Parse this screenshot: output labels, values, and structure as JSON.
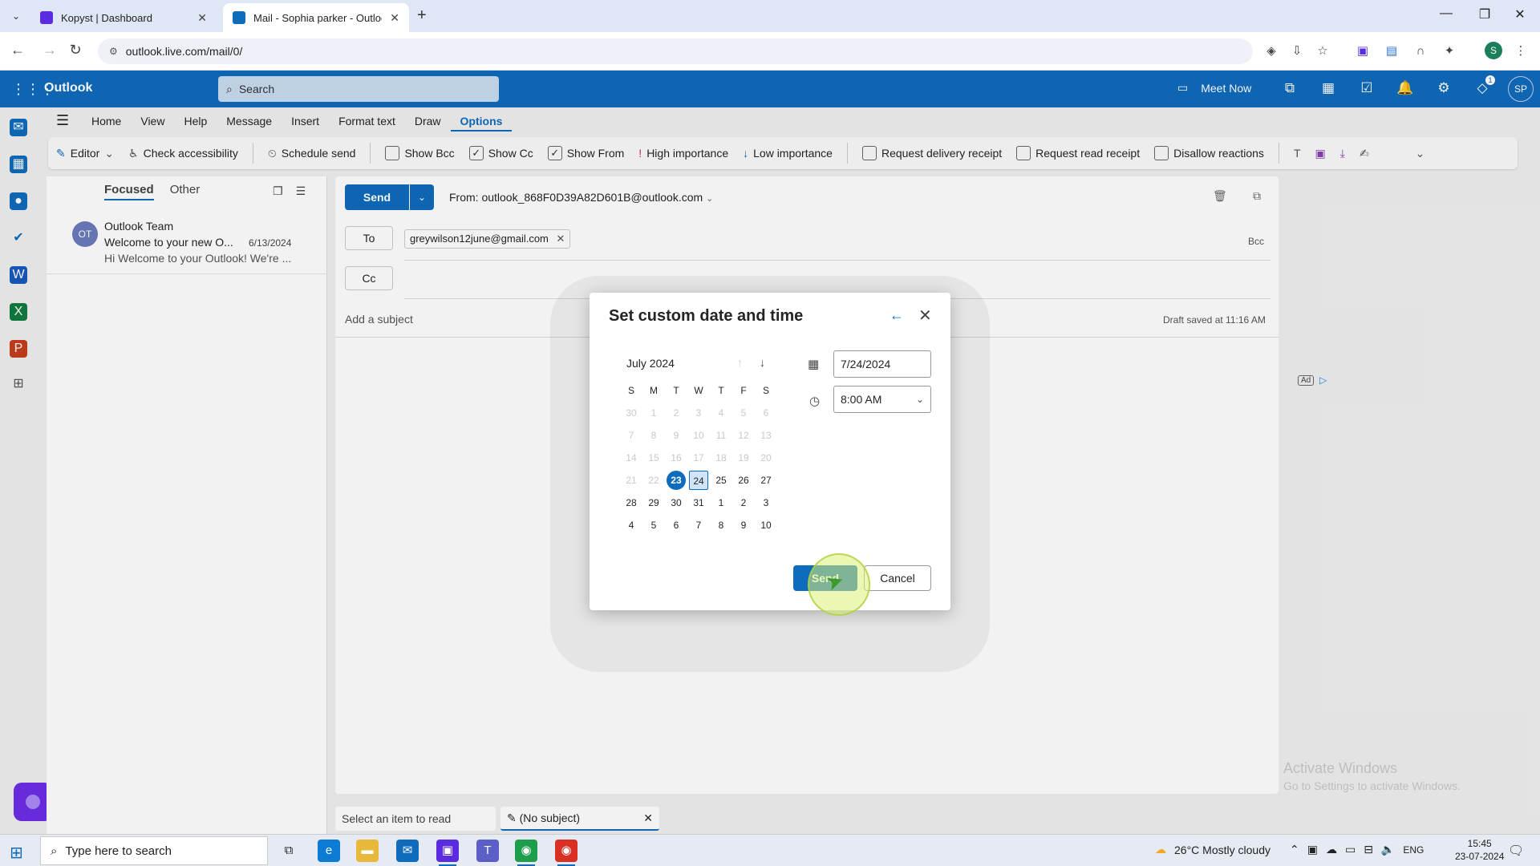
{
  "browser": {
    "tabs": [
      {
        "title": "Kopyst | Dashboard",
        "active": false,
        "favicon_color": "#5b2be0"
      },
      {
        "title": "Mail - Sophia parker - Outlook",
        "active": true,
        "favicon_color": "#0f6cbd"
      }
    ],
    "url": "outlook.live.com/mail/0/",
    "profile_initial": "S"
  },
  "outlook": {
    "brand": "Outlook",
    "search_placeholder": "Search",
    "meet_now": "Meet Now",
    "notification_badge": "1",
    "avatar_initials": "SP",
    "ribbon_tabs": [
      "Home",
      "View",
      "Help",
      "Message",
      "Insert",
      "Format text",
      "Draw",
      "Options"
    ],
    "active_ribbon_tab": "Options",
    "ribbon": {
      "editor": "Editor",
      "check_accessibility": "Check accessibility",
      "schedule_send": "Schedule send",
      "show_bcc": "Show Bcc",
      "show_cc": "Show Cc",
      "show_from": "Show From",
      "high_importance": "High importance",
      "low_importance": "Low importance",
      "request_delivery_receipt": "Request delivery receipt",
      "request_read_receipt": "Request read receipt",
      "disallow_reactions": "Disallow reactions"
    },
    "ribbon_checks": {
      "show_bcc": false,
      "show_cc": true,
      "show_from": true,
      "delivery": false,
      "read": false,
      "reactions": false
    },
    "message_list": {
      "focused": "Focused",
      "other": "Other",
      "items": [
        {
          "initials": "OT",
          "sender": "Outlook Team",
          "subject": "Welcome to your new O...",
          "date": "6/13/2024",
          "preview": "Hi Welcome to your Outlook! We're ..."
        }
      ]
    },
    "compose": {
      "send": "Send",
      "from": "From: outlook_868F0D39A82D601B@outlook.com",
      "to_label": "To",
      "cc_label": "Cc",
      "recipient": "greywilson12june@gmail.com",
      "bcc": "Bcc",
      "subject_placeholder": "Add a subject",
      "draft_saved": "Draft saved at 11:16 AM"
    },
    "bottom_tabs": {
      "select_item": "Select an item to read",
      "no_subject": "(No subject)"
    },
    "ad_label": "Ad"
  },
  "dialog": {
    "title": "Set custom date and time",
    "month": "July 2024",
    "weekdays": [
      "S",
      "M",
      "T",
      "W",
      "T",
      "F",
      "S"
    ],
    "weeks": [
      [
        "30",
        "1",
        "2",
        "3",
        "4",
        "5",
        "6"
      ],
      [
        "7",
        "8",
        "9",
        "10",
        "11",
        "12",
        "13"
      ],
      [
        "14",
        "15",
        "16",
        "17",
        "18",
        "19",
        "20"
      ],
      [
        "21",
        "22",
        "23",
        "24",
        "25",
        "26",
        "27"
      ],
      [
        "28",
        "29",
        "30",
        "31",
        "1",
        "2",
        "3"
      ],
      [
        "4",
        "5",
        "6",
        "7",
        "8",
        "9",
        "10"
      ]
    ],
    "today": "23",
    "selected": "24",
    "date_value": "7/24/2024",
    "time_value": "8:00 AM",
    "send_label": "Send",
    "cancel_label": "Cancel"
  },
  "watermark": {
    "title": "Activate Windows",
    "subtitle": "Go to Settings to activate Windows."
  },
  "taskbar": {
    "search_placeholder": "Type here to search",
    "weather": "26°C  Mostly cloudy",
    "language": "ENG",
    "time": "15:45",
    "date": "23-07-2024"
  },
  "colors": {
    "accent": "#0f6cbd",
    "header_bg": "#0f6cbd"
  }
}
